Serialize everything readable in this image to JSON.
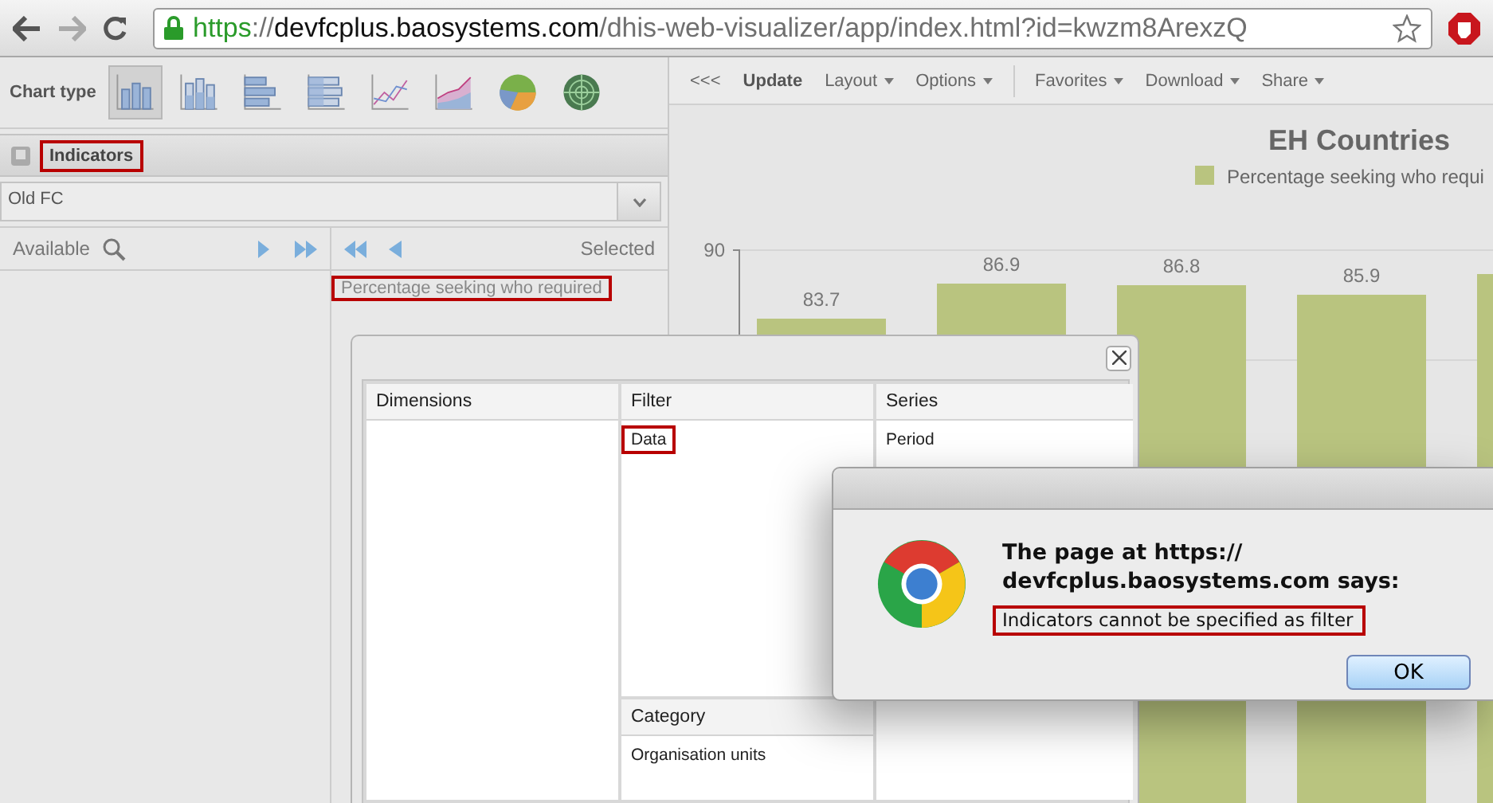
{
  "browser": {
    "address": {
      "scheme": "https",
      "separator": "://",
      "host": "devfcplus.baosystems.com",
      "path": "/dhis-web-visualizer/app/index.html?id=kwzm8ArexzQ"
    }
  },
  "left_panel": {
    "chart_type_label": "Chart type",
    "chart_types": [
      {
        "kind": "column",
        "selected": true
      },
      {
        "kind": "stacked-column",
        "selected": false
      },
      {
        "kind": "bar",
        "selected": false
      },
      {
        "kind": "stacked-bar",
        "selected": false
      },
      {
        "kind": "line",
        "selected": false
      },
      {
        "kind": "area",
        "selected": false
      },
      {
        "kind": "pie",
        "selected": false
      },
      {
        "kind": "radar",
        "selected": false
      }
    ],
    "section": {
      "title": "Indicators",
      "highlighted": true
    },
    "group_select": {
      "value": "Old FC"
    },
    "available_label": "Available",
    "selected_label": "Selected",
    "selected_items": [
      {
        "label": "Percentage seeking who required",
        "highlighted": true
      }
    ]
  },
  "chart_panel": {
    "toolbar": {
      "groups": [
        [
          {
            "label": "<<<",
            "kind": "button"
          },
          {
            "label": "Update",
            "kind": "primary"
          },
          {
            "label": "Layout",
            "kind": "menu"
          },
          {
            "label": "Options",
            "kind": "menu"
          }
        ],
        [
          {
            "label": "Favorites",
            "kind": "menu"
          },
          {
            "label": "Download",
            "kind": "menu"
          },
          {
            "label": "Share",
            "kind": "menu"
          }
        ]
      ]
    },
    "chart": {
      "title": "EH Countries",
      "legend": "Percentage seeking who requi",
      "axis_label": "90",
      "bar_labels": [
        "83.7",
        "86.9",
        "86.8",
        "85.9"
      ]
    }
  },
  "layout_dialog": {
    "dimensions": {
      "title": "Dimensions"
    },
    "filter": {
      "title": "Filter",
      "items": [
        {
          "label": "Data",
          "highlighted": true
        }
      ]
    },
    "series": {
      "title": "Series",
      "items": [
        {
          "label": "Period",
          "highlighted": false
        }
      ]
    },
    "category": {
      "title": "Category",
      "items": [
        {
          "label": "Organisation units",
          "highlighted": false
        }
      ]
    }
  },
  "alert": {
    "heading": "The page at https:// devfcplus.baosystems.com says:",
    "message": "Indicators cannot be specified as filter",
    "message_highlighted": true,
    "button": "OK"
  }
}
